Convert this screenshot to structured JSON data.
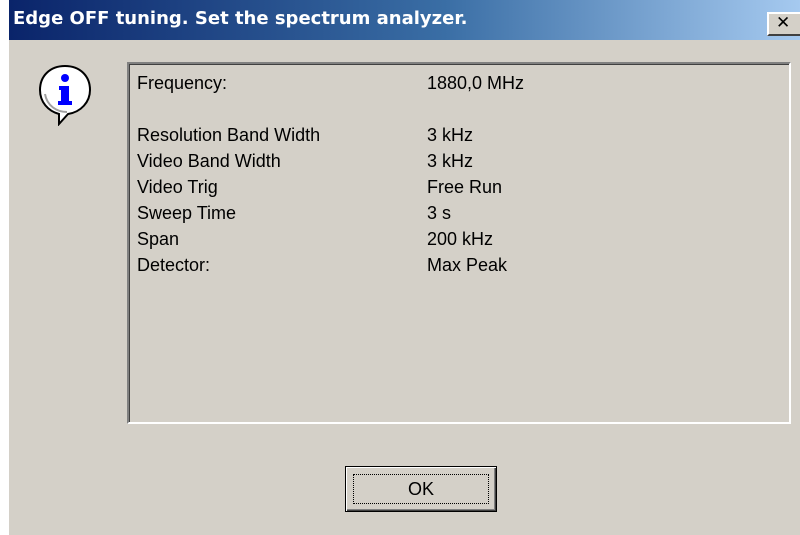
{
  "window": {
    "title": "Edge OFF tuning. Set the spectrum analyzer.",
    "close_glyph": "✕",
    "title_gradient_start": "#0a246a",
    "title_gradient_end": "#a6caf0",
    "background": "#d4d0c8"
  },
  "icon": {
    "name": "info-icon",
    "glyph": "i",
    "color": "#0000ff"
  },
  "settings": [
    {
      "label": "Frequency:",
      "value": "1880,0 MHz"
    },
    {
      "label": "Resolution Band Width",
      "value": "3 kHz"
    },
    {
      "label": "Video Band Width",
      "value": "3 kHz"
    },
    {
      "label": "Video Trig",
      "value": "Free Run"
    },
    {
      "label": "Sweep Time",
      "value": "3 s"
    },
    {
      "label": "Span",
      "value": "200 kHz"
    },
    {
      "label": "Detector:",
      "value": "Max Peak"
    }
  ],
  "buttons": {
    "ok_label": "OK"
  }
}
